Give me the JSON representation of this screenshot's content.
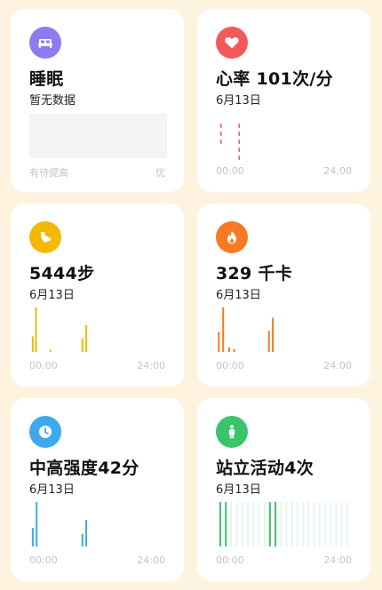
{
  "cards": {
    "sleep": {
      "title": "睡眠",
      "subtitle": "暂无数据",
      "scale_left": "有待提高",
      "scale_right": "优",
      "icon": "bed-icon",
      "color": "#8c7cf0"
    },
    "heart": {
      "title": "心率 101次/分",
      "subtitle": "6月13日",
      "x_start": "00:00",
      "x_end": "24:00",
      "icon": "heart-icon",
      "color": "#f25a5a"
    },
    "steps": {
      "title": "5444步",
      "subtitle": "6月13日",
      "x_start": "00:00",
      "x_end": "24:00",
      "icon": "shoe-icon",
      "color": "#f5b800"
    },
    "calories": {
      "title": "329 千卡",
      "subtitle": "6月13日",
      "x_start": "00:00",
      "x_end": "24:00",
      "icon": "flame-icon",
      "color": "#f57a23"
    },
    "intensity": {
      "title": "中高强度42分",
      "subtitle": "6月13日",
      "x_start": "00:00",
      "x_end": "24:00",
      "icon": "clock-icon",
      "color": "#3da9ee"
    },
    "standing": {
      "title": "站立活动4次",
      "subtitle": "6月13日",
      "x_start": "00:00",
      "x_end": "24:00",
      "icon": "standing-person-icon",
      "color": "#3bc46b"
    }
  },
  "chart_data": [
    {
      "type": "bar",
      "chart": "heart",
      "x_range": [
        0,
        24
      ],
      "series": [
        {
          "values": [
            [
              0.6,
              0.9
            ],
            [
              3.9,
              4.2
            ]
          ]
        }
      ]
    },
    {
      "type": "bar",
      "chart": "steps",
      "x_range": [
        0,
        24
      ],
      "series": [
        {
          "values": [
            [
              0.3,
              0.35
            ],
            [
              0.9,
              1.0
            ],
            [
              3.5,
              0.05
            ],
            [
              9.3,
              0.3
            ],
            [
              10.0,
              0.6
            ]
          ]
        }
      ]
    },
    {
      "type": "bar",
      "chart": "calories",
      "x_range": [
        0,
        24
      ],
      "series": [
        {
          "values": [
            [
              0.2,
              0.45
            ],
            [
              1.0,
              1.0
            ],
            [
              2.1,
              0.1
            ],
            [
              3.0,
              0.06
            ],
            [
              9.3,
              0.47
            ],
            [
              10.0,
              0.77
            ]
          ]
        }
      ]
    },
    {
      "type": "bar",
      "chart": "intensity",
      "x_range": [
        0,
        24
      ],
      "series": [
        {
          "values": [
            [
              0.3,
              0.42
            ],
            [
              1.0,
              1.0
            ],
            [
              9.3,
              0.28
            ],
            [
              10.0,
              0.6
            ]
          ]
        }
      ]
    },
    {
      "type": "bar",
      "chart": "standing",
      "x_range": [
        0,
        24
      ],
      "series": [
        {
          "name": "active",
          "values": [
            0,
            1,
            9,
            10
          ]
        },
        {
          "name": "inactive",
          "values": [
            2,
            3,
            4,
            5,
            6,
            7,
            8,
            11,
            12,
            13,
            14,
            15,
            16,
            17,
            18,
            19,
            20,
            21,
            22,
            23
          ]
        }
      ]
    }
  ]
}
